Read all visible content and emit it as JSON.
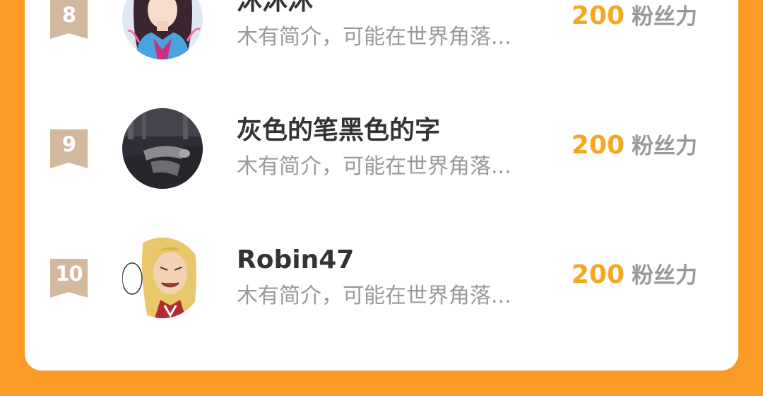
{
  "ranking": {
    "items": [
      {
        "rank": "8",
        "name": "沐沐沐",
        "bio": "木有简介，可能在世界角落...",
        "fans_count": "200",
        "fans_label": "粉丝力",
        "avatar_icon": "anime-girl-avatar"
      },
      {
        "rank": "9",
        "name": "灰色的笔黑色的字",
        "bio": "木有简介，可能在世界角落...",
        "fans_count": "200",
        "fans_label": "粉丝力",
        "avatar_icon": "photo-avatar"
      },
      {
        "rank": "10",
        "name": "Robin47",
        "bio": "木有简介，可能在世界角落...",
        "fans_count": "200",
        "fans_label": "粉丝力",
        "avatar_icon": "manga-avatar"
      }
    ]
  },
  "colors": {
    "page_background": "#fb9a26",
    "card_background": "#ffffff",
    "rank_badge": "#d3b89d",
    "fans_count": "#f5a623",
    "name_text": "#333333",
    "secondary_text": "#999999"
  }
}
